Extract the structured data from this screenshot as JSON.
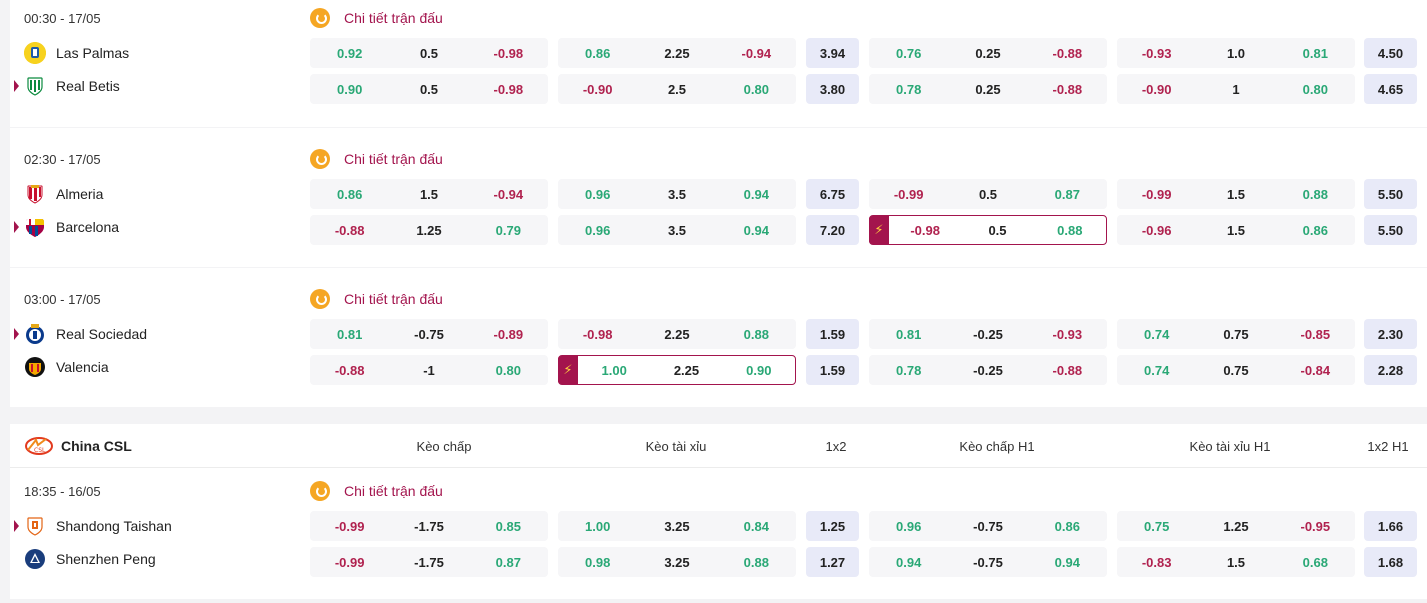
{
  "detail_label": "Chi tiết trận đấu",
  "league": {
    "name": "China CSL",
    "columns": [
      "Kèo chấp",
      "Kèo tài xỉu",
      "1x2",
      "Kèo chấp H1",
      "Kèo tài xỉu H1",
      "1x2 H1"
    ]
  },
  "matches": [
    {
      "time": "00:30 - 17/05",
      "teams": [
        {
          "name": "Las Palmas",
          "logo": "las-palmas-logo",
          "marker": false,
          "handicap": [
            "0.92",
            "0.5",
            "-0.98"
          ],
          "ou": [
            "0.86",
            "2.25",
            "-0.94"
          ],
          "x12": "3.94",
          "handicap_h1": [
            "0.76",
            "0.25",
            "-0.88"
          ],
          "ou_h1": [
            "-0.93",
            "1.0",
            "0.81"
          ],
          "x12_h1": "4.50"
        },
        {
          "name": "Real Betis",
          "logo": "real-betis-logo",
          "marker": true,
          "handicap": [
            "0.90",
            "0.5",
            "-0.98"
          ],
          "ou": [
            "-0.90",
            "2.5",
            "0.80"
          ],
          "x12": "3.80",
          "handicap_h1": [
            "0.78",
            "0.25",
            "-0.88"
          ],
          "ou_h1": [
            "-0.90",
            "1",
            "0.80"
          ],
          "x12_h1": "4.65"
        }
      ]
    },
    {
      "time": "02:30 - 17/05",
      "teams": [
        {
          "name": "Almeria",
          "logo": "almeria-logo",
          "marker": false,
          "handicap": [
            "0.86",
            "1.5",
            "-0.94"
          ],
          "ou": [
            "0.96",
            "3.5",
            "0.94"
          ],
          "x12": "6.75",
          "handicap_h1": [
            "-0.99",
            "0.5",
            "0.87"
          ],
          "ou_h1": [
            "-0.99",
            "1.5",
            "0.88"
          ],
          "x12_h1": "5.50"
        },
        {
          "name": "Barcelona",
          "logo": "barcelona-logo",
          "marker": true,
          "handicap": [
            "-0.88",
            "1.25",
            "0.79"
          ],
          "ou": [
            "0.96",
            "3.5",
            "0.94"
          ],
          "x12": "7.20",
          "handicap_h1": [
            "-0.98",
            "0.5",
            "0.88"
          ],
          "ou_h1": [
            "-0.96",
            "1.5",
            "0.86"
          ],
          "x12_h1": "5.50"
        }
      ]
    },
    {
      "time": "03:00 - 17/05",
      "teams": [
        {
          "name": "Real Sociedad",
          "logo": "real-sociedad-logo",
          "marker": true,
          "handicap": [
            "0.81",
            "-0.75",
            "-0.89"
          ],
          "ou": [
            "-0.98",
            "2.25",
            "0.88"
          ],
          "x12": "1.59",
          "handicap_h1": [
            "0.81",
            "-0.25",
            "-0.93"
          ],
          "ou_h1": [
            "0.74",
            "0.75",
            "-0.85"
          ],
          "x12_h1": "2.30"
        },
        {
          "name": "Valencia",
          "logo": "valencia-logo",
          "marker": false,
          "handicap": [
            "-0.88",
            "-1",
            "0.80"
          ],
          "ou": [
            "1.00",
            "2.25",
            "0.90"
          ],
          "x12": "1.59",
          "handicap_h1": [
            "0.78",
            "-0.25",
            "-0.88"
          ],
          "ou_h1": [
            "0.74",
            "0.75",
            "-0.84"
          ],
          "x12_h1": "2.28"
        }
      ]
    },
    {
      "time": "18:35 - 16/05",
      "teams": [
        {
          "name": "Shandong Taishan",
          "logo": "shandong-taishan-logo",
          "marker": true,
          "handicap": [
            "-0.99",
            "-1.75",
            "0.85"
          ],
          "ou": [
            "1.00",
            "3.25",
            "0.84"
          ],
          "x12": "1.25",
          "handicap_h1": [
            "0.96",
            "-0.75",
            "0.86"
          ],
          "ou_h1": [
            "0.75",
            "1.25",
            "-0.95"
          ],
          "x12_h1": "1.66"
        },
        {
          "name": "Shenzhen Peng",
          "logo": "shenzhen-peng-logo",
          "marker": false,
          "handicap": [
            "-0.99",
            "-1.75",
            "0.87"
          ],
          "ou": [
            "0.98",
            "3.25",
            "0.88"
          ],
          "x12": "1.27",
          "handicap_h1": [
            "0.94",
            "-0.75",
            "0.94"
          ],
          "ou_h1": [
            "-0.83",
            "1.5",
            "0.68"
          ],
          "x12_h1": "1.68"
        }
      ]
    }
  ],
  "colors": {
    "positive": "#2aa876",
    "negative": "#b0224f",
    "accent": "#a3144d",
    "x12_bg": "#e8eaf8"
  }
}
